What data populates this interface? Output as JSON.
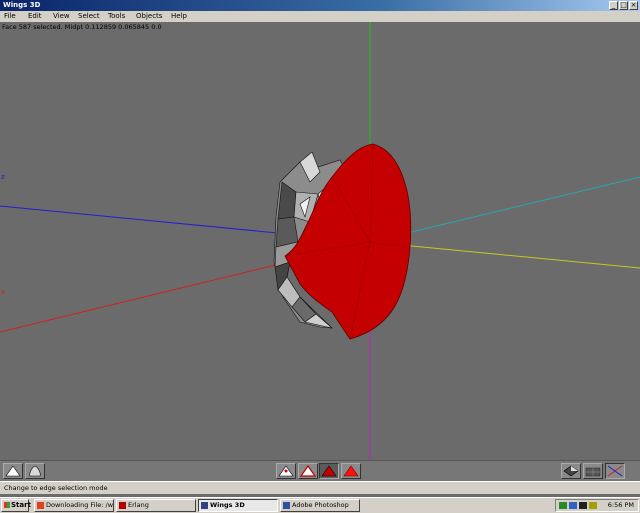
{
  "window": {
    "title": "Wings 3D"
  },
  "menu": [
    "File",
    "Edit",
    "View",
    "Select",
    "Tools",
    "Objects",
    "Help"
  ],
  "viewport": {
    "info": "Face 587 selected. Midpt 0.112859 0.065845 0.0",
    "axis_labels": {
      "z": "z",
      "x": "x"
    },
    "colors": {
      "background": "#6b6b6b",
      "selection": "#c40000",
      "x_axis": "#d02020",
      "y_axis": "#20c020",
      "z_axis": "#2020d0"
    }
  },
  "toolbar": {
    "left_modes": [
      "vertex-select-icon",
      "edge-select-icon"
    ],
    "center_modes": [
      "vertex-mode-icon",
      "edge-mode-icon",
      "face-mode-icon",
      "body-mode-icon"
    ],
    "right_modes": [
      "perspective-icon",
      "groundplane-icon",
      "axes-icon"
    ]
  },
  "status": {
    "message": "Change to edge selection mode"
  },
  "taskbar": {
    "start_label": "Start",
    "tasks": [
      "Downloading File: /wings/...",
      "Erlang",
      "Wings 3D",
      "Adobe Photoshop"
    ],
    "active_task": "Wings 3D",
    "clock": "6:56 PM"
  }
}
